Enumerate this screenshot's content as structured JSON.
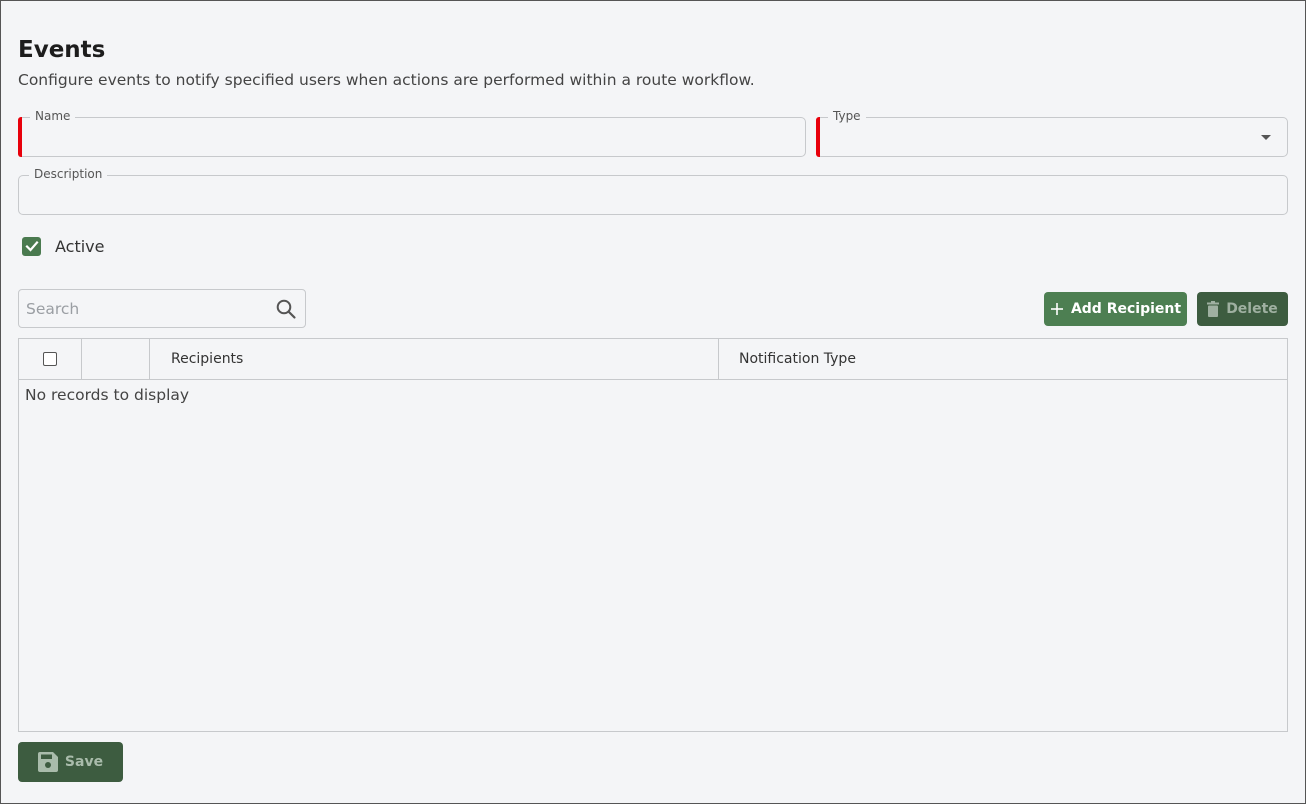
{
  "page": {
    "title": "Events",
    "subtitle": "Configure events to notify specified users when actions are performed within a route workflow."
  },
  "form": {
    "name_label": "Name",
    "name_value": "",
    "type_label": "Type",
    "type_value": "",
    "description_label": "Description",
    "description_value": "",
    "active_label": "Active",
    "active_checked": true
  },
  "toolbar": {
    "search_placeholder": "Search",
    "add_recipient_label": "Add Recipient",
    "delete_label": "Delete"
  },
  "table": {
    "columns": [
      "",
      "",
      "Recipients",
      "Notification Type"
    ],
    "rows": [],
    "empty_text": "No records to display"
  },
  "footer": {
    "save_label": "Save"
  },
  "colors": {
    "primary_green": "#4d7f52",
    "dark_green": "#3d5c40",
    "required_red": "#e8000b",
    "background": "#f4f5f7"
  },
  "icons": {
    "search": "search-icon",
    "add": "plus-icon",
    "delete": "trash-icon",
    "save": "floppy-disk-icon",
    "checkbox": "check-icon",
    "dropdown": "caret-down-icon"
  }
}
